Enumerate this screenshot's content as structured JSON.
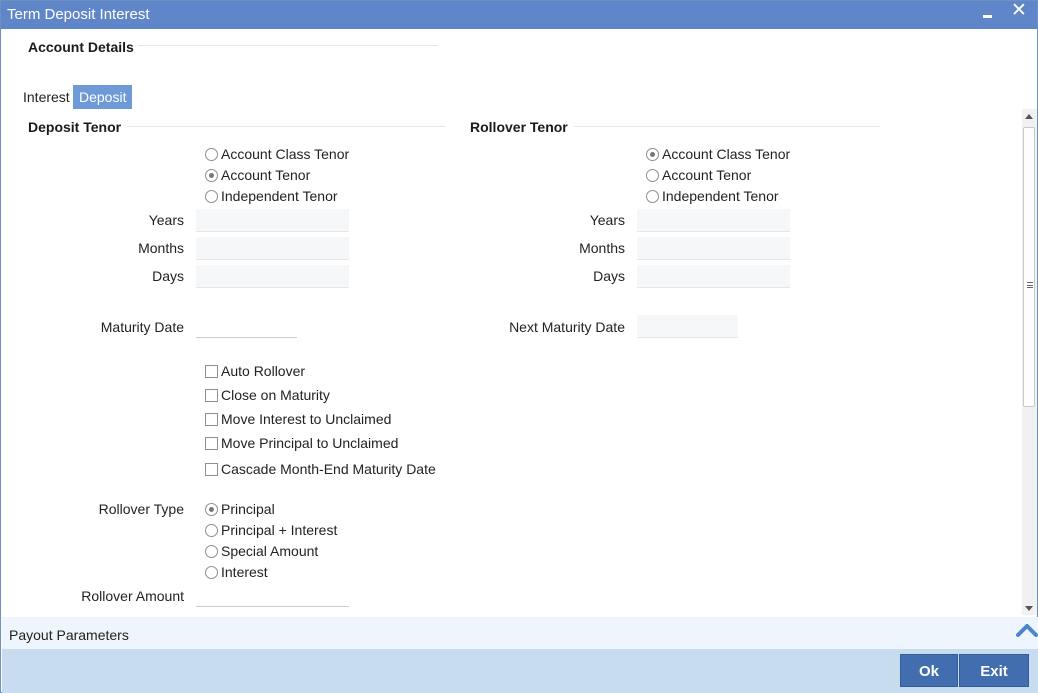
{
  "window": {
    "title": "Term Deposit Interest"
  },
  "sections": {
    "account_details": "Account Details",
    "deposit_tenor": "Deposit Tenor",
    "rollover_tenor": "Rollover Tenor"
  },
  "tabs": [
    {
      "label": "Interest",
      "active": false
    },
    {
      "label": "Deposit",
      "active": true
    }
  ],
  "deposit_tenor": {
    "options": [
      {
        "label": "Account Class Tenor",
        "selected": false
      },
      {
        "label": "Account Tenor",
        "selected": true
      },
      {
        "label": "Independent Tenor",
        "selected": false
      }
    ],
    "years_label": "Years",
    "months_label": "Months",
    "days_label": "Days",
    "years": "",
    "months": "",
    "days": ""
  },
  "rollover_tenor": {
    "options": [
      {
        "label": "Account Class Tenor",
        "selected": true
      },
      {
        "label": "Account Tenor",
        "selected": false
      },
      {
        "label": "Independent Tenor",
        "selected": false
      }
    ],
    "years_label": "Years",
    "months_label": "Months",
    "days_label": "Days",
    "years": "",
    "months": "",
    "days": ""
  },
  "maturity_date_label": "Maturity Date",
  "maturity_date": "",
  "next_maturity_date_label": "Next Maturity Date",
  "next_maturity_date": "",
  "checkboxes": [
    {
      "label": "Auto Rollover",
      "checked": false
    },
    {
      "label": "Close on Maturity",
      "checked": false
    },
    {
      "label": "Move Interest to Unclaimed",
      "checked": false
    },
    {
      "label": "Move Principal to Unclaimed",
      "checked": false
    },
    {
      "label": "Cascade Month-End Maturity Date",
      "checked": false
    }
  ],
  "rollover_type": {
    "label": "Rollover Type",
    "options": [
      {
        "label": "Principal",
        "selected": true
      },
      {
        "label": "Principal + Interest",
        "selected": false
      },
      {
        "label": "Special Amount",
        "selected": false
      },
      {
        "label": "Interest",
        "selected": false
      }
    ]
  },
  "rollover_amount_label": "Rollover Amount",
  "rollover_amount": "",
  "payout_parameters": "Payout Parameters",
  "buttons": {
    "ok": "Ok",
    "exit": "Exit"
  },
  "colors": {
    "titlebar": "#5f86c9",
    "active_tab": "#6f9ad8",
    "button": "#426eaf",
    "footer": "#c7dcef"
  }
}
